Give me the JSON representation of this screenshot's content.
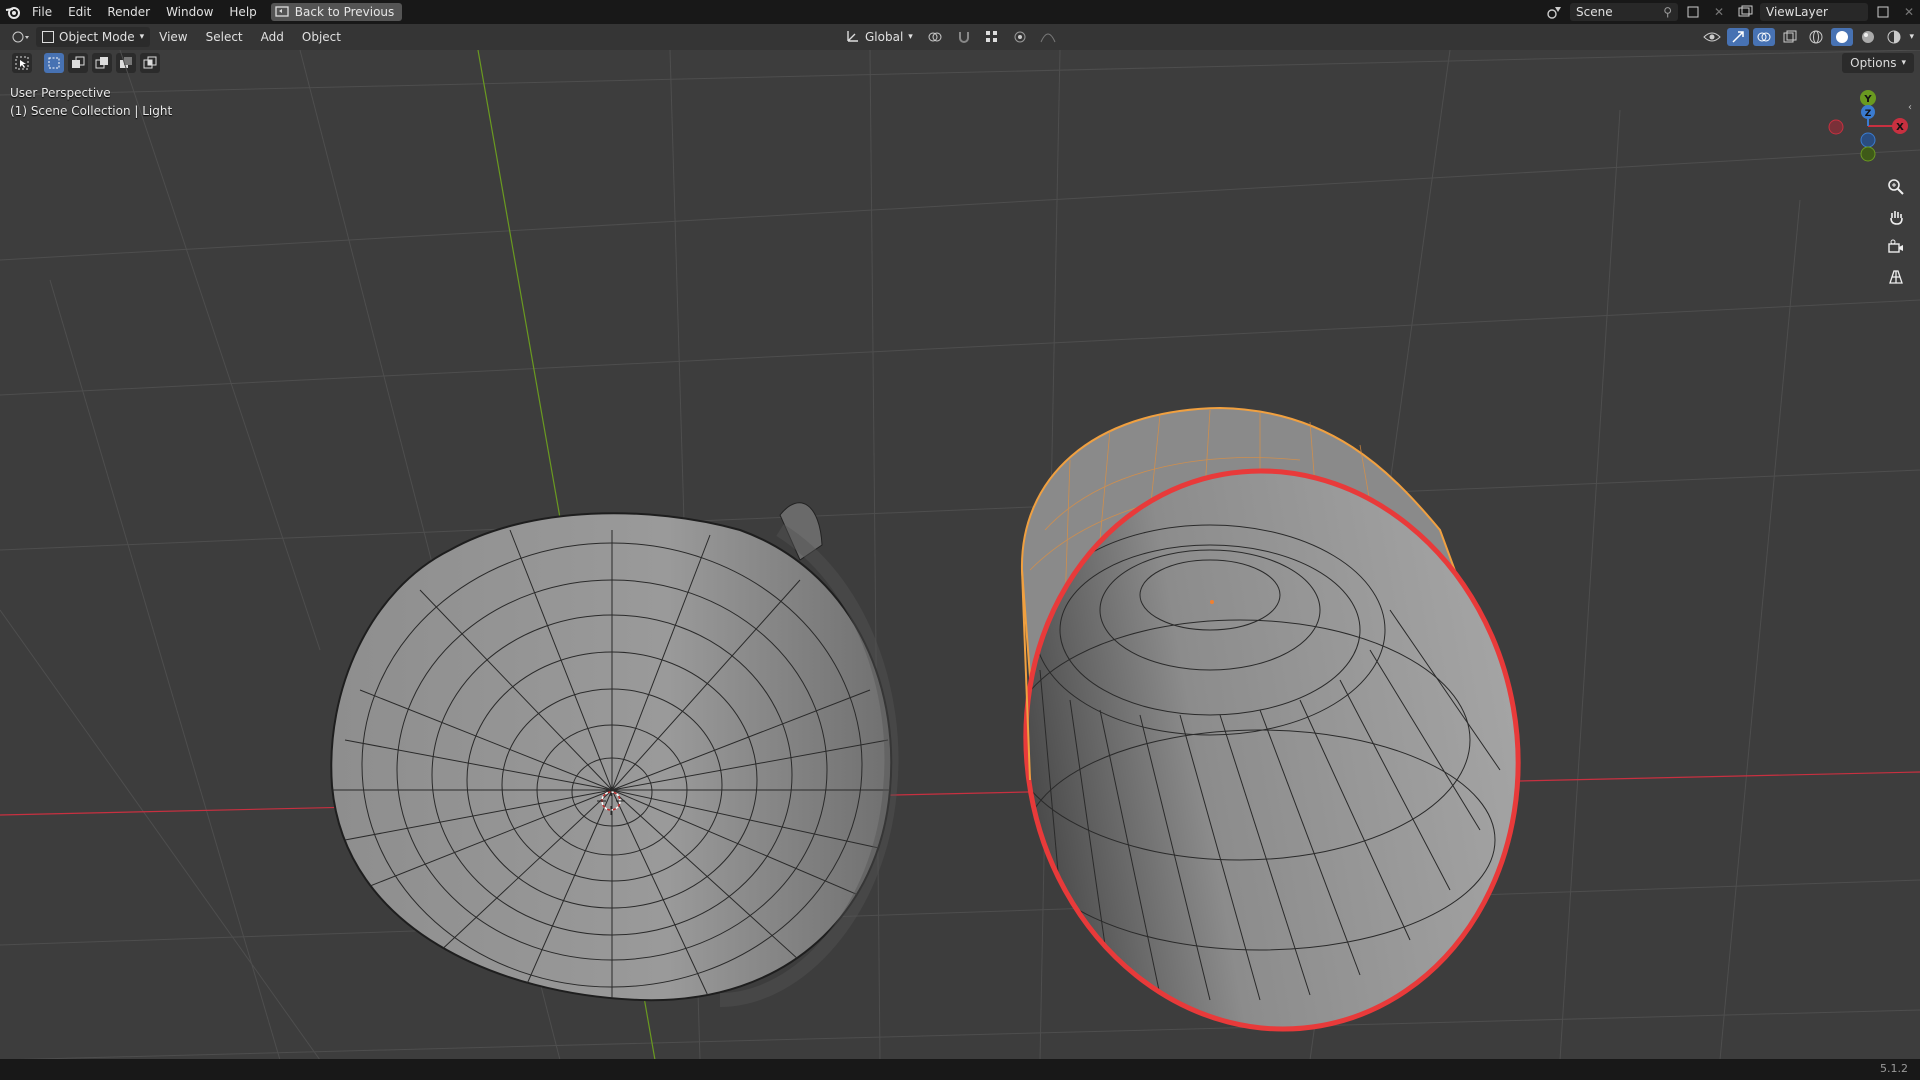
{
  "menubar": {
    "items": [
      "File",
      "Edit",
      "Render",
      "Window",
      "Help"
    ],
    "back_button": "Back to Previous"
  },
  "topright": {
    "scene": "Scene",
    "view_layer": "ViewLayer"
  },
  "header": {
    "mode": "Object Mode",
    "menus": [
      "View",
      "Select",
      "Add",
      "Object"
    ],
    "orientation": "Global"
  },
  "viewport": {
    "perspective": "User Perspective",
    "collection": "(1) Scene Collection | Light",
    "options": "Options"
  },
  "gizmo": {
    "x": "X",
    "y": "Y",
    "z": "Z"
  },
  "status": {
    "version": "5.1.2"
  },
  "colors": {
    "background": "#3d3d3d",
    "selection_outline": "#f0a040",
    "active_edge": "#e83a3a",
    "x_axis": "#c83040",
    "y_axis": "#6a9a20",
    "z_axis": "#3a7bd0"
  }
}
